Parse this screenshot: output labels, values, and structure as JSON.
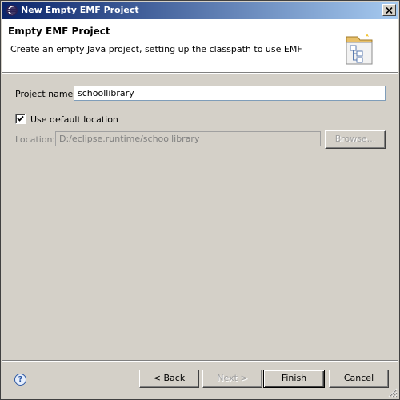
{
  "window": {
    "title": "New Empty EMF Project"
  },
  "header": {
    "title": "Empty EMF Project",
    "description": "Create an empty Java project, setting up the classpath to use EMF"
  },
  "form": {
    "project_name_label": "Project name:",
    "project_name_value": "schoollibrary",
    "use_default_location_label": "Use default location",
    "use_default_location_checked": true,
    "location_label": "Location:",
    "location_value": "D:/eclipse.runtime/schoollibrary",
    "browse_label": "Browse..."
  },
  "buttons": {
    "help": "?",
    "back": "< Back",
    "next": "Next >",
    "finish": "Finish",
    "cancel": "Cancel"
  },
  "colors": {
    "titlebar_start": "#0a246a",
    "titlebar_end": "#a6caf0",
    "dialog_bg": "#d4d0c8"
  }
}
